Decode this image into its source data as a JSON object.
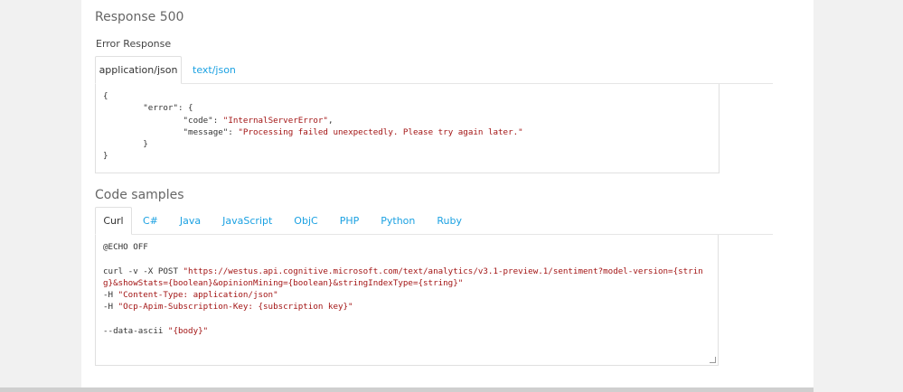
{
  "response": {
    "title": "Response 500",
    "subtitle": "Error Response",
    "tabs": [
      "application/json",
      "text/json"
    ],
    "code_lines": [
      {
        "indent": "",
        "key": "",
        "value": "{"
      },
      {
        "indent": "        ",
        "key": "\"error\": {",
        "value": ""
      },
      {
        "indent": "                ",
        "key": "\"code\": ",
        "value": "\"InternalServerError\"",
        "tail": ","
      },
      {
        "indent": "                ",
        "key": "\"message\": ",
        "value": "\"Processing failed unexpectedly. Please try again later.\"",
        "tail": ""
      },
      {
        "indent": "        ",
        "key": "}",
        "value": ""
      },
      {
        "indent": "",
        "key": "}",
        "value": ""
      }
    ]
  },
  "samples": {
    "title": "Code samples",
    "tabs": [
      "Curl",
      "C#",
      "Java",
      "JavaScript",
      "ObjC",
      "PHP",
      "Python",
      "Ruby"
    ],
    "echo": "@ECHO OFF",
    "curl_cmd": "curl -v -X POST ",
    "curl_url": "\"https://westus.api.cognitive.microsoft.com/text/analytics/v3.1-preview.1/sentiment?model-version={string}&showStats={boolean}&opinionMining={boolean}&stringIndexType={string}\"",
    "header1_flag": "-H ",
    "header1_val": "\"Content-Type: application/json\"",
    "header2_flag": "-H ",
    "header2_val": "\"Ocp-Apim-Subscription-Key: {subscription key}\"",
    "data_flag": "--data-ascii ",
    "data_val": "\"{body}\""
  }
}
